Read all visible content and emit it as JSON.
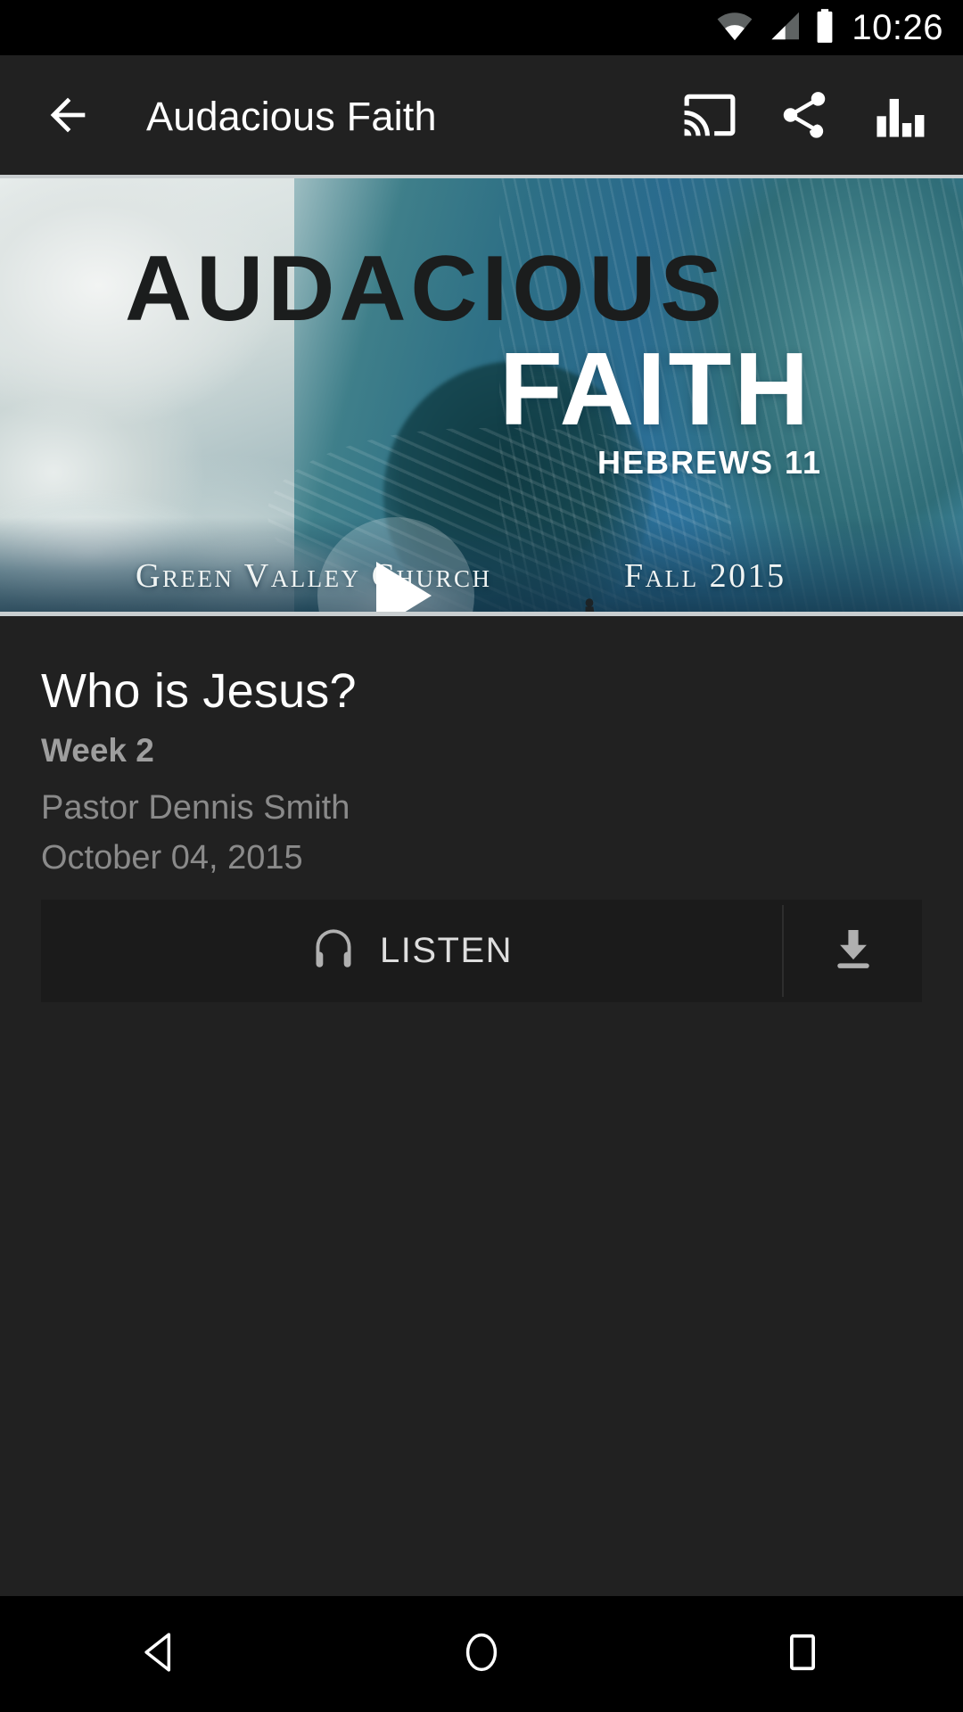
{
  "status_bar": {
    "clock": "10:26",
    "icons": [
      "wifi-icon",
      "cellular-signal-icon",
      "battery-icon"
    ]
  },
  "app_bar": {
    "title": "Audacious Faith",
    "back_icon": "back-arrow-icon",
    "actions": [
      {
        "name": "cast-icon",
        "label": "Cast"
      },
      {
        "name": "share-icon",
        "label": "Share"
      },
      {
        "name": "stats-bar-chart-icon",
        "label": "Stats"
      }
    ]
  },
  "hero": {
    "series_word_1": "AUDACIOUS",
    "series_word_2": "FAITH",
    "scripture_reference": "HEBREWS 11",
    "church_name": "Green Valley Church",
    "season": "Fall 2015",
    "play_icon": "play-icon",
    "alt": "Surfer riding inside a large breaking ocean wave"
  },
  "sermon": {
    "title": "Who is Jesus?",
    "week": "Week 2",
    "speaker": "Pastor Dennis Smith",
    "date": "October 04, 2015"
  },
  "actions": {
    "listen_label": "LISTEN",
    "listen_icon": "headphones-icon",
    "download_icon": "download-icon"
  },
  "nav_bar": {
    "back_label": "Back",
    "home_label": "Home",
    "recents_label": "Recents"
  },
  "colors": {
    "status_bar_bg": "#000000",
    "app_bar_bg": "#212121",
    "content_bg": "#212121",
    "action_bg": "#1b1b1b",
    "primary_text": "#ffffff",
    "secondary_text": "#9e9e9e",
    "muted_text": "#8a8a8a"
  }
}
